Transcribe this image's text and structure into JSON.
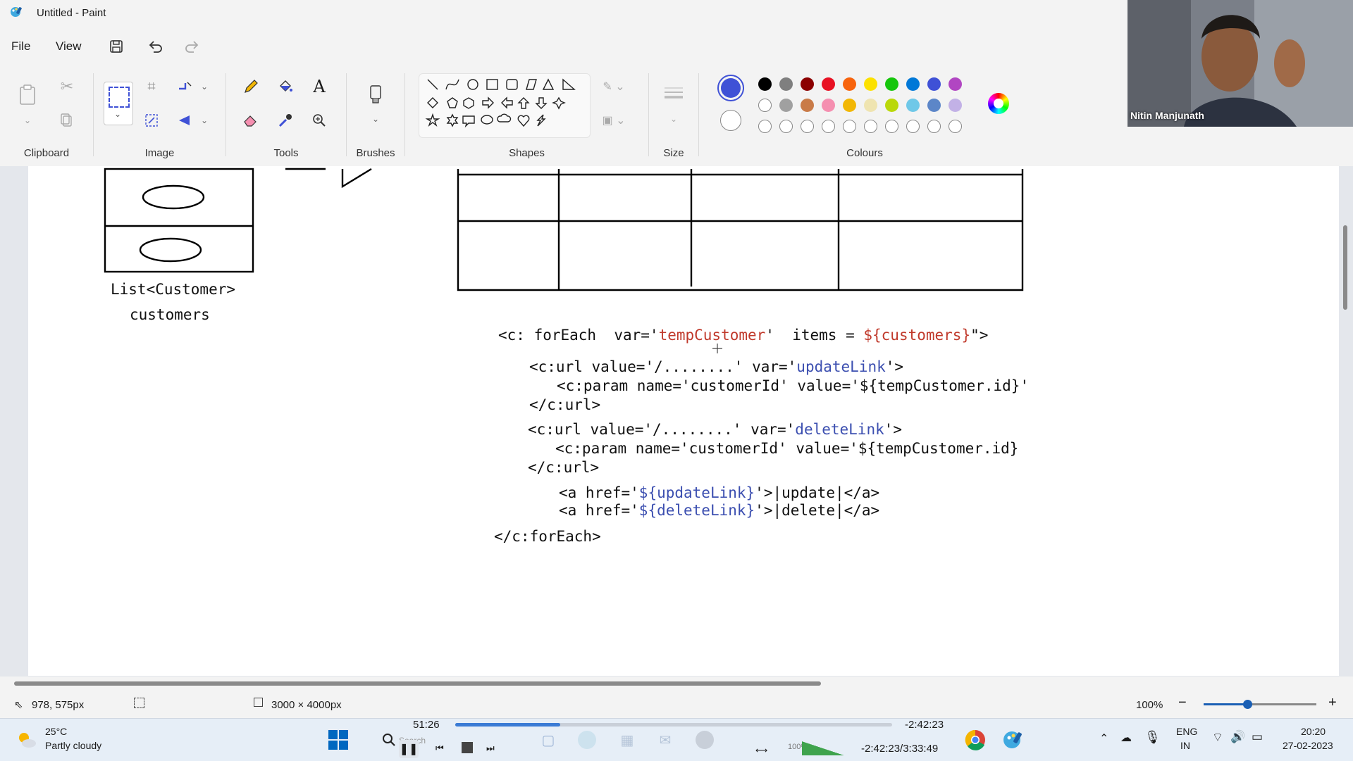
{
  "window": {
    "title": "Untitled - Paint"
  },
  "menu": {
    "file": "File",
    "view": "View"
  },
  "ribbon": {
    "clipboard": "Clipboard",
    "image": "Image",
    "tools": "Tools",
    "brushes": "Brushes",
    "shapes": "Shapes",
    "size": "Size",
    "colours": "Colours"
  },
  "colors": {
    "primary": "#3f51d6",
    "secondary": "#ffffff",
    "palette_row1": [
      "#000000",
      "#7f7f7f",
      "#8b0000",
      "#e81123",
      "#f7630c",
      "#fce100",
      "#16c60c",
      "#0078d7",
      "#3f51d6",
      "#b146c2"
    ],
    "palette_row2": [
      "#ffffff",
      "#a0a0a0",
      "#c97b48",
      "#f58fb0",
      "#f2b705",
      "#efe4b0",
      "#bad80a",
      "#6fc8e8",
      "#5c86c8",
      "#c2b1e6"
    ]
  },
  "drawing": {
    "list_label": "List<Customer>",
    "list_var": "customers",
    "code": {
      "line1_a": "<c: forEach  var='",
      "line1_b": "tempCustomer",
      "line1_c": "'  items = ",
      "line1_d": "${customers}",
      "line1_e": "\">",
      "line2_a": "<c:url value='/........' var='",
      "line2_b": "updateLink",
      "line2_c": "'>",
      "line3": "<c:param name='customerId' value='${tempCustomer.id}'",
      "line4": "</c:url>",
      "line5_a": "<c:url value='/........' var='",
      "line5_b": "deleteLink",
      "line5_c": "'>",
      "line6": "<c:param name='customerId' value='${tempCustomer.id}",
      "line7": "</c:url>",
      "line8_a": "<a href='",
      "line8_b": "${updateLink}",
      "line8_c": "'>|update|</a>",
      "line9_a": "<a href='",
      "line9_b": "${deleteLink}",
      "line9_c": "'>|delete|</a>",
      "line10": "</c:forEach>"
    }
  },
  "status": {
    "cursor_pos": "978, 575px",
    "canvas_size": "3000 × 4000px",
    "zoom": "100%"
  },
  "media": {
    "elapsed": "51:26",
    "remaining": "-2:42:23",
    "total": "-2:42:23/3:33:49",
    "progress_fraction": 0.24
  },
  "taskbar": {
    "temp": "25°C",
    "weather": "Partly cloudy",
    "search": "Search",
    "lang1": "ENG",
    "lang2": "IN",
    "time": "20:20",
    "date": "27-02-2023",
    "volume_label": "100%"
  },
  "webcam": {
    "name": "Nitin Manjunath"
  }
}
